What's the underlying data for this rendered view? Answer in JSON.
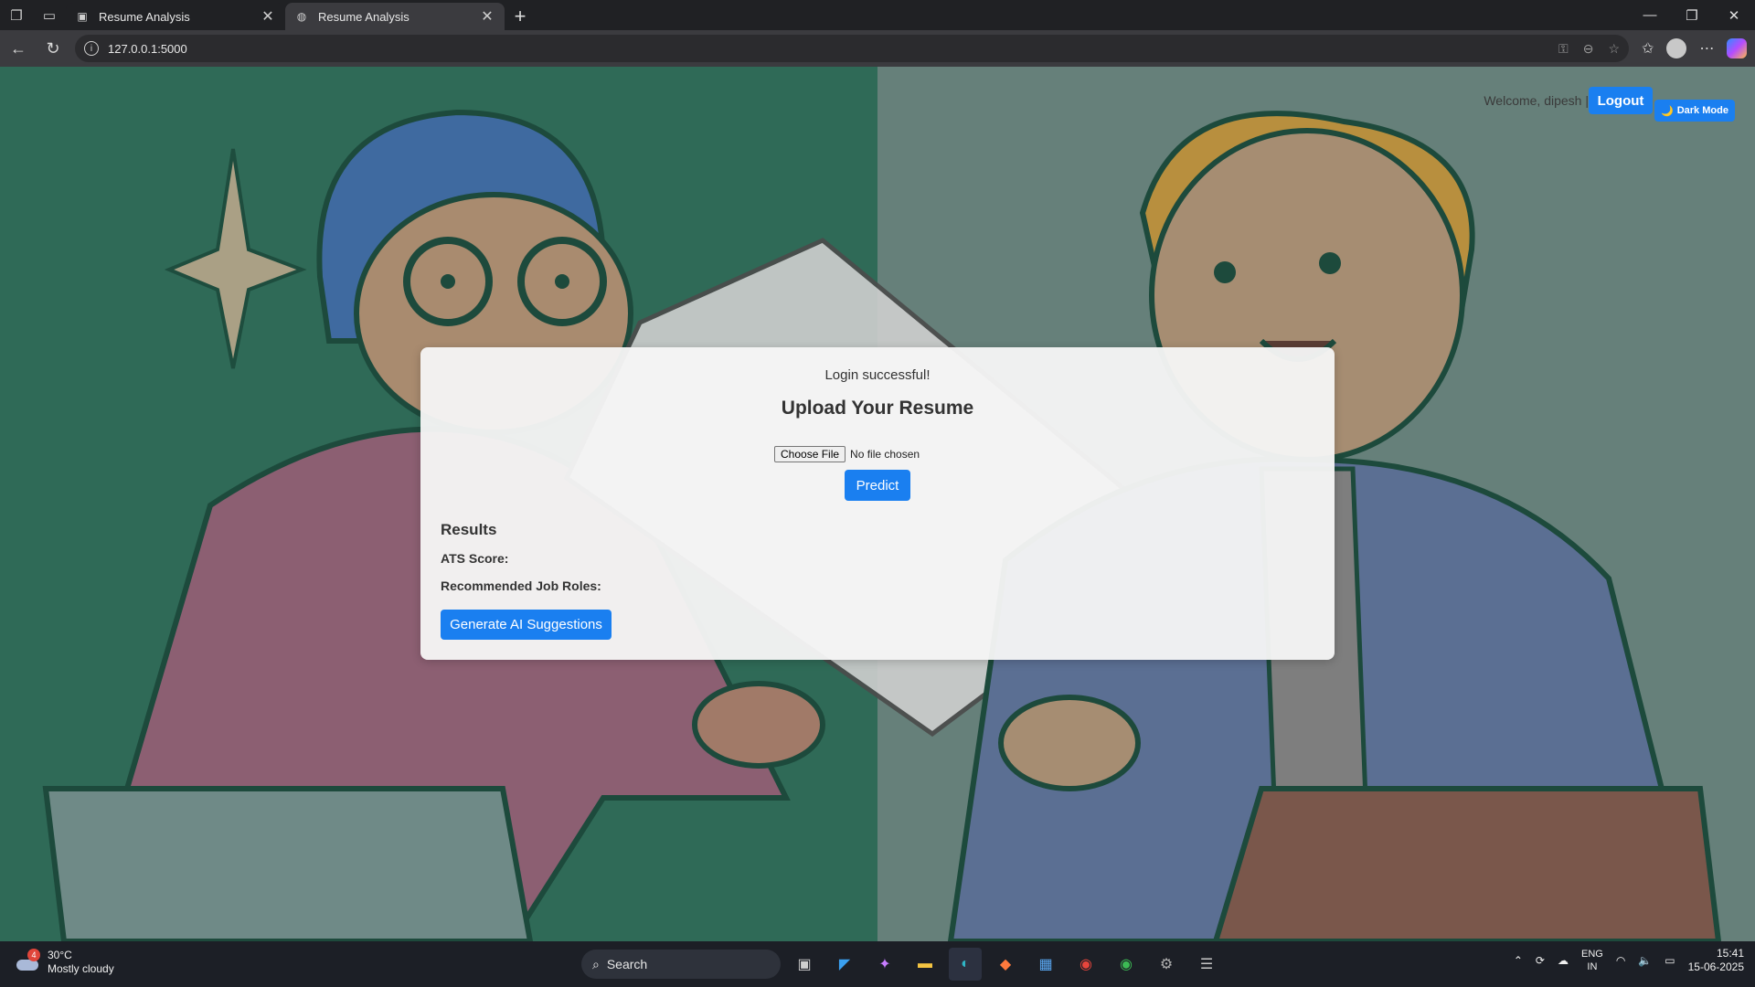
{
  "browser": {
    "tabs": [
      {
        "title": "Resume Analysis",
        "active": false
      },
      {
        "title": "Resume Analysis",
        "active": true
      }
    ],
    "url": "127.0.0.1:5000"
  },
  "header": {
    "welcome_text": "Welcome, dipesh |",
    "logout_label": "Logout",
    "dark_mode_label": "Dark Mode",
    "dark_mode_icon": "🌙"
  },
  "card": {
    "flash_message": "Login successful!",
    "title": "Upload Your Resume",
    "file_button_label": "Choose File",
    "file_status": "No file chosen",
    "predict_label": "Predict",
    "results_title": "Results",
    "ats_label": "ATS Score:",
    "roles_label": "Recommended Job Roles:",
    "generate_label": "Generate AI Suggestions"
  },
  "taskbar": {
    "weather_temp": "30°C",
    "weather_desc": "Mostly cloudy",
    "weather_badge": "4",
    "search_label": "Search",
    "lang_line1": "ENG",
    "lang_line2": "IN",
    "time": "15:41",
    "date": "15-06-2025"
  },
  "colors": {
    "accent": "#1a7ff0",
    "bg_left": "#2f6a57",
    "bg_right": "#66807a"
  }
}
